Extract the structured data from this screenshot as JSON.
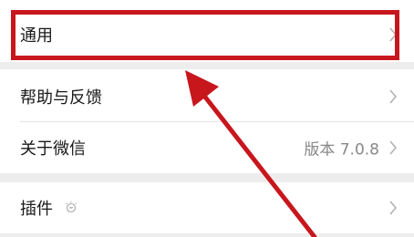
{
  "settings": {
    "items": [
      {
        "label": "通用",
        "value": ""
      },
      {
        "label": "帮助与反馈",
        "value": ""
      },
      {
        "label": "关于微信",
        "value": "版本 7.0.8"
      },
      {
        "label": "插件",
        "value": ""
      }
    ]
  },
  "icons": {
    "chevron": "chevron-right-icon",
    "plugin": "plugin-bulb-icon"
  },
  "colors": {
    "annotation": "#c8161d",
    "background": "#ededed",
    "row_background": "#ffffff",
    "secondary_text": "#888888"
  }
}
